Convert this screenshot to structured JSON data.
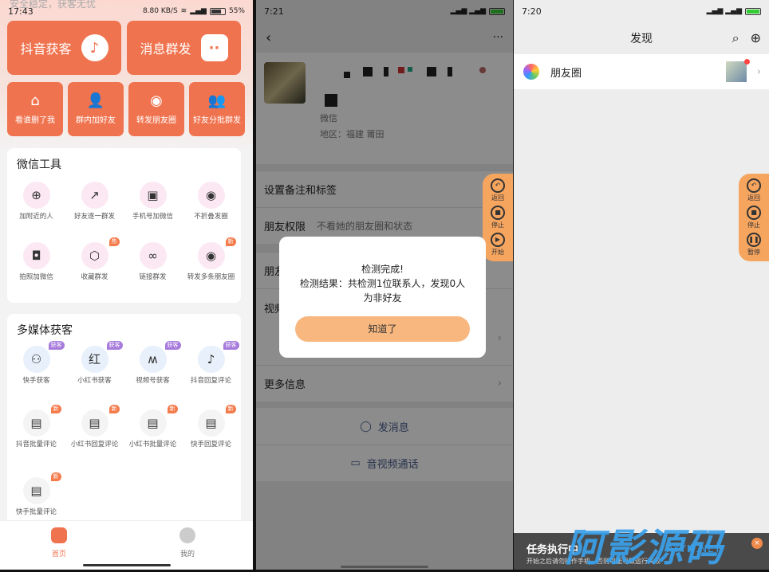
{
  "p1": {
    "ghost_text": "安全稳定，获客无忧",
    "status": {
      "time": "17:43",
      "net": "8.80 KB/S",
      "battery": "55%"
    },
    "big_buttons": [
      {
        "label": "抖音获客",
        "icon": "tiktok-icon",
        "glyph": "♪"
      },
      {
        "label": "消息群发",
        "icon": "chat-bubble-icon",
        "glyph": "··"
      }
    ],
    "small_buttons": [
      {
        "label": "看谁删了我",
        "icon": "broom-icon",
        "glyph": "⌂"
      },
      {
        "label": "群内加好友",
        "icon": "add-user-icon",
        "glyph": "👤"
      },
      {
        "label": "转发朋友圈",
        "icon": "aperture-icon",
        "glyph": "◉"
      },
      {
        "label": "好友分批群发",
        "icon": "group-icon",
        "glyph": "👥"
      }
    ],
    "wechat_tools": {
      "title": "微信工具",
      "items": [
        {
          "label": "加附近的人",
          "icon": "location-plus-icon",
          "glyph": "⊕",
          "badge": ""
        },
        {
          "label": "好友逐一群发",
          "icon": "share-square-icon",
          "glyph": "↗",
          "badge": ""
        },
        {
          "label": "手机号加微信",
          "icon": "contact-card-icon",
          "glyph": "▣",
          "badge": ""
        },
        {
          "label": "不折叠发圈",
          "icon": "aperture-icon",
          "glyph": "◉",
          "badge": ""
        },
        {
          "label": "拍照加微信",
          "icon": "camera-plus-icon",
          "glyph": "◘",
          "badge": ""
        },
        {
          "label": "收藏群发",
          "icon": "cube-icon",
          "glyph": "⬡",
          "badge": "热"
        },
        {
          "label": "链接群发",
          "icon": "link-icon",
          "glyph": "∞",
          "badge": ""
        },
        {
          "label": "转发多条朋友圈",
          "icon": "aperture-icon",
          "glyph": "◉",
          "badge": "新"
        }
      ]
    },
    "media_tools": {
      "title": "多媒体获客",
      "items": [
        {
          "label": "快手获客",
          "icon": "kuaishou-icon",
          "glyph": "⚇",
          "badge": "获客"
        },
        {
          "label": "小红书获客",
          "icon": "xiaohongshu-icon",
          "glyph": "红",
          "badge": "获客"
        },
        {
          "label": "视频号获客",
          "icon": "channels-icon",
          "glyph": "ʍ",
          "badge": "获客"
        },
        {
          "label": "抖音回复评论",
          "icon": "tiktok-icon",
          "glyph": "♪",
          "badge": "获客"
        },
        {
          "label": "抖音批量评论",
          "icon": "comment-batch-icon",
          "glyph": "▤",
          "badge": "新"
        },
        {
          "label": "小红书回复评论",
          "icon": "document-reply-icon",
          "glyph": "▤",
          "badge": "新"
        },
        {
          "label": "小红书批量评论",
          "icon": "comment-batch-icon",
          "glyph": "▤",
          "badge": "新"
        },
        {
          "label": "快手回复评论",
          "icon": "document-reply-icon",
          "glyph": "▤",
          "badge": "新"
        },
        {
          "label": "快手批量评论",
          "icon": "comment-batch-icon",
          "glyph": "▤",
          "badge": "新"
        }
      ]
    },
    "nav": {
      "home": "首页",
      "mine": "我的"
    }
  },
  "p2": {
    "status": {
      "time": "7:21"
    },
    "header": {
      "back": "‹",
      "more": "···"
    },
    "profile": {
      "wechat_id_label": "微信",
      "region_label": "地区：",
      "region_value": "福建  莆田"
    },
    "rows": [
      {
        "label": "设置备注和标签",
        "sub": ""
      },
      {
        "label": "朋友权限",
        "sub": "不看她的朋友圈和状态"
      },
      {
        "label": "朋友",
        "sub": ""
      },
      {
        "label": "视频",
        "sub": ""
      },
      {
        "label": "更多信息",
        "sub": ""
      }
    ],
    "actions": {
      "message": "发消息",
      "call": "音视频通话"
    },
    "dialog": {
      "line1": "检测完成!",
      "line2": "检测结果：共检测1位联系人，发现0人",
      "line3": "为非好友",
      "button": "知道了"
    },
    "float": [
      {
        "label": "返回",
        "icon": "back-arrow-icon",
        "glyph": "↶"
      },
      {
        "label": "停止",
        "icon": "stop-icon",
        "glyph": "■"
      },
      {
        "label": "开始",
        "icon": "play-icon",
        "glyph": "▶"
      }
    ]
  },
  "p3": {
    "status": {
      "time": "7:20"
    },
    "title": "发现",
    "moments": "朋友圈",
    "float": [
      {
        "label": "返回",
        "icon": "back-arrow-icon",
        "glyph": "↶"
      },
      {
        "label": "停止",
        "icon": "stop-icon",
        "glyph": "■"
      },
      {
        "label": "暂停",
        "icon": "pause-icon",
        "glyph": "❚❚"
      }
    ],
    "toast": {
      "title": "任务执行中",
      "desc": "开始之后请勿操作手机，否则可能导致运行失败",
      "close": "×"
    }
  },
  "watermark": {
    "main": "阿影源码",
    "sub": "AYYM.NET"
  }
}
